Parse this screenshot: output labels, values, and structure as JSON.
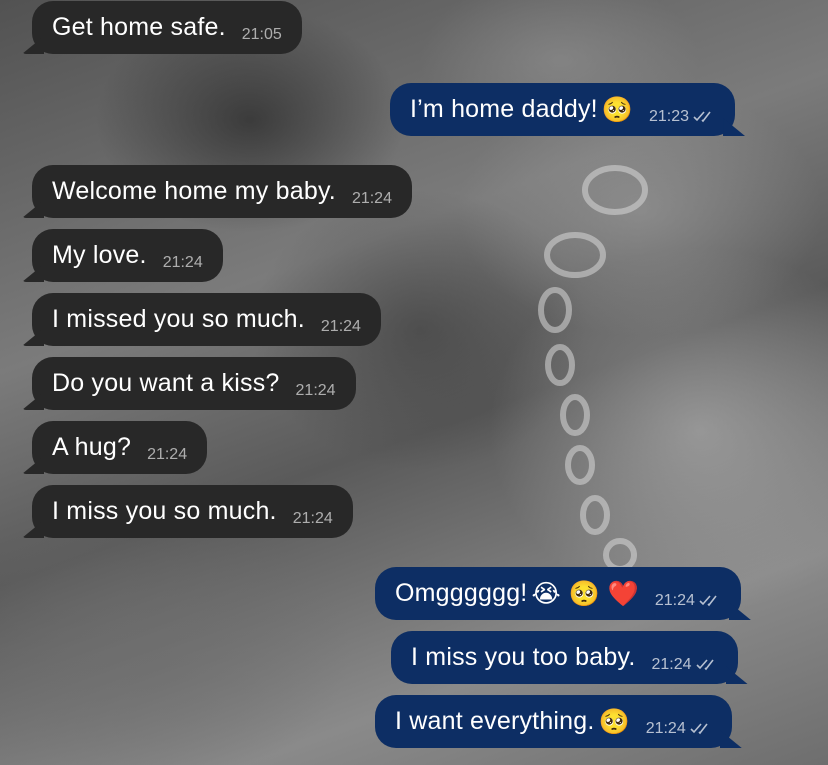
{
  "chat": {
    "messages": [
      {
        "direction": "in",
        "text": "Get home safe.",
        "emoji": "",
        "time": "21:05"
      },
      {
        "direction": "out",
        "text": "I’m home daddy!",
        "emoji": "🥺",
        "time": "21:23",
        "status": "read"
      },
      {
        "direction": "in",
        "text": "Welcome home my baby.",
        "emoji": "",
        "time": "21:24"
      },
      {
        "direction": "in",
        "text": "My love.",
        "emoji": "",
        "time": "21:24"
      },
      {
        "direction": "in",
        "text": "I missed you so much.",
        "emoji": "",
        "time": "21:24"
      },
      {
        "direction": "in",
        "text": "Do you want a kiss?",
        "emoji": "",
        "time": "21:24"
      },
      {
        "direction": "in",
        "text": "A hug?",
        "emoji": "",
        "time": "21:24"
      },
      {
        "direction": "in",
        "text": "I miss you so much.",
        "emoji": "",
        "time": "21:24"
      },
      {
        "direction": "out",
        "text": "Omgggggg!",
        "emoji": "😭 🥺 ❤️",
        "time": "21:24",
        "status": "read"
      },
      {
        "direction": "out",
        "text": "I miss you too baby.",
        "emoji": "",
        "time": "21:24",
        "status": "read"
      },
      {
        "direction": "out",
        "text": "I want everything.",
        "emoji": "🥺",
        "time": "21:24",
        "status": "read"
      }
    ]
  },
  "colors": {
    "incoming_bubble": "#282828",
    "outgoing_bubble": "#0d2e64"
  },
  "icons": {
    "read_receipt": "double-check-icon"
  }
}
